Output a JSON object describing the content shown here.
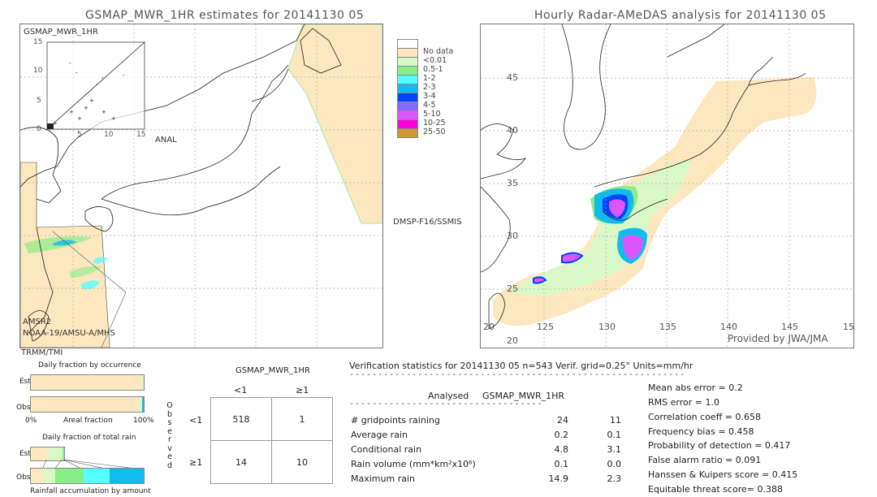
{
  "chart_data": [
    {
      "type": "heatmap",
      "title": "GSMAP_MWR_1HR estimates for 20141130 05",
      "region": "Japan and surroundings",
      "inset": {
        "type": "scatter",
        "title": "GSMAP_MWR_1HR",
        "xlabel": "ANAL",
        "xlim": [
          0,
          15
        ],
        "ylim": [
          0,
          15
        ],
        "x_ticks": [
          "0",
          "5",
          "10",
          "15"
        ],
        "y_ticks": [
          "0",
          "5",
          "10",
          "15"
        ]
      },
      "satellite_labels": [
        "DMSP-F16/SSMIS",
        "AMSR2",
        "NOAA-19/AMSU-A/MHS",
        "TRMM/TMI"
      ]
    },
    {
      "type": "heatmap",
      "title": "Hourly Radar-AMeDAS analysis for 20141130 05",
      "x_ticks": [
        "20",
        "125",
        "130",
        "135",
        "140",
        "145",
        "15"
      ],
      "y_ticks": [
        "45",
        "40",
        "35",
        "30",
        "25",
        "20"
      ],
      "credit": "Provided by JWA/JMA"
    },
    {
      "type": "bar",
      "title": "Daily fraction by occurrence",
      "categories": [
        "Est",
        "Obs"
      ],
      "xlabel": "Areal fraction",
      "x_ticks": [
        "0%",
        "100%"
      ]
    },
    {
      "type": "bar",
      "title": "Daily fraction of total rain",
      "categories": [
        "Est",
        "Obs"
      ],
      "xlabel": "Rainfall accumulation by amount"
    },
    {
      "type": "table",
      "title": "GSMAP_MWR_1HR",
      "col_headers": [
        "<1",
        "≥1"
      ],
      "row_label": "Observed",
      "row_headers": [
        "<1",
        "≥1"
      ],
      "cells": [
        [
          "518",
          "1"
        ],
        [
          "14",
          "10"
        ]
      ]
    }
  ],
  "legend": {
    "items": [
      {
        "label": "",
        "color": "#ffffff"
      },
      {
        "label": "No data",
        "color": "#fde7bf"
      },
      {
        "label": "<0.01",
        "color": "#d8f8c8"
      },
      {
        "label": "0.5-1",
        "color": "#88ee88"
      },
      {
        "label": "1-2",
        "color": "#55ffff"
      },
      {
        "label": "2-3",
        "color": "#11bbee"
      },
      {
        "label": "3-4",
        "color": "#0044ff"
      },
      {
        "label": "4-5",
        "color": "#8866ff"
      },
      {
        "label": "5-10",
        "color": "#dd55ff"
      },
      {
        "label": "10-25",
        "color": "#ff00dd"
      },
      {
        "label": "25-50",
        "color": "#cc9933"
      }
    ]
  },
  "left_map": {
    "title": "GSMAP_MWR_1HR estimates for 20141130 05",
    "inset_title": "GSMAP_MWR_1HR",
    "inset_xlabel": "ANAL",
    "inset_ticks": [
      "0",
      "5",
      "10",
      "15"
    ],
    "sat_dmsp": "DMSP-F16/SSMIS",
    "sat_amsr2": "AMSR2",
    "sat_noaa": "NOAA-19/AMSU-A/MHS",
    "sat_trmm": "TRMM/TMI"
  },
  "right_map": {
    "title": "Hourly Radar-AMeDAS analysis for 20141130 05",
    "lat_labels": [
      "45",
      "40",
      "35",
      "30",
      "25",
      "20"
    ],
    "lon_labels": [
      "20",
      "125",
      "130",
      "135",
      "140",
      "145",
      "15"
    ],
    "credit": "Provided by JWA/JMA"
  },
  "occurrence": {
    "title": "Daily fraction by occurrence",
    "est": "Est",
    "obs": "Obs",
    "x_min": "0%",
    "x_label": "Areal fraction",
    "x_max": "100%"
  },
  "total_rain": {
    "title": "Daily fraction of total rain",
    "est": "Est",
    "obs": "Obs",
    "x_label": "Rainfall accumulation by amount"
  },
  "contingency": {
    "title": "GSMAP_MWR_1HR",
    "col_lt": "<1",
    "col_ge": "≥1",
    "observed_letters": [
      "O",
      "b",
      "s",
      "e",
      "r",
      "v",
      "e",
      "d"
    ],
    "row_lt": "<1",
    "row_ge": "≥1",
    "c11": "518",
    "c12": "1",
    "c21": "14",
    "c22": "10"
  },
  "verification": {
    "header": "Verification statistics for 20141130 05   n=543   Verif. grid=0.25°   Units=mm/hr",
    "col_analysed": "Analysed",
    "col_gsmap": "GSMAP_MWR_1HR",
    "rows": [
      {
        "label": "# gridpoints raining",
        "analysed": "24",
        "gsmap": "11"
      },
      {
        "label": "Average rain",
        "analysed": "0.2",
        "gsmap": "0.1"
      },
      {
        "label": "Conditional rain",
        "analysed": "4.8",
        "gsmap": "3.1"
      },
      {
        "label": "Rain volume (mm*km²x10⁶)",
        "analysed": "0.1",
        "gsmap": "0.0"
      },
      {
        "label": "Maximum rain",
        "analysed": "14.9",
        "gsmap": "2.3"
      }
    ],
    "scores": [
      "Mean abs error = 0.2",
      "RMS error = 1.0",
      "Correlation coeff = 0.658",
      "Frequency bias = 0.458",
      "Probability of detection = 0.417",
      "False alarm ratio = 0.091",
      "Hanssen & Kuipers score = 0.415",
      "Equitable threat score= 0.388"
    ]
  }
}
